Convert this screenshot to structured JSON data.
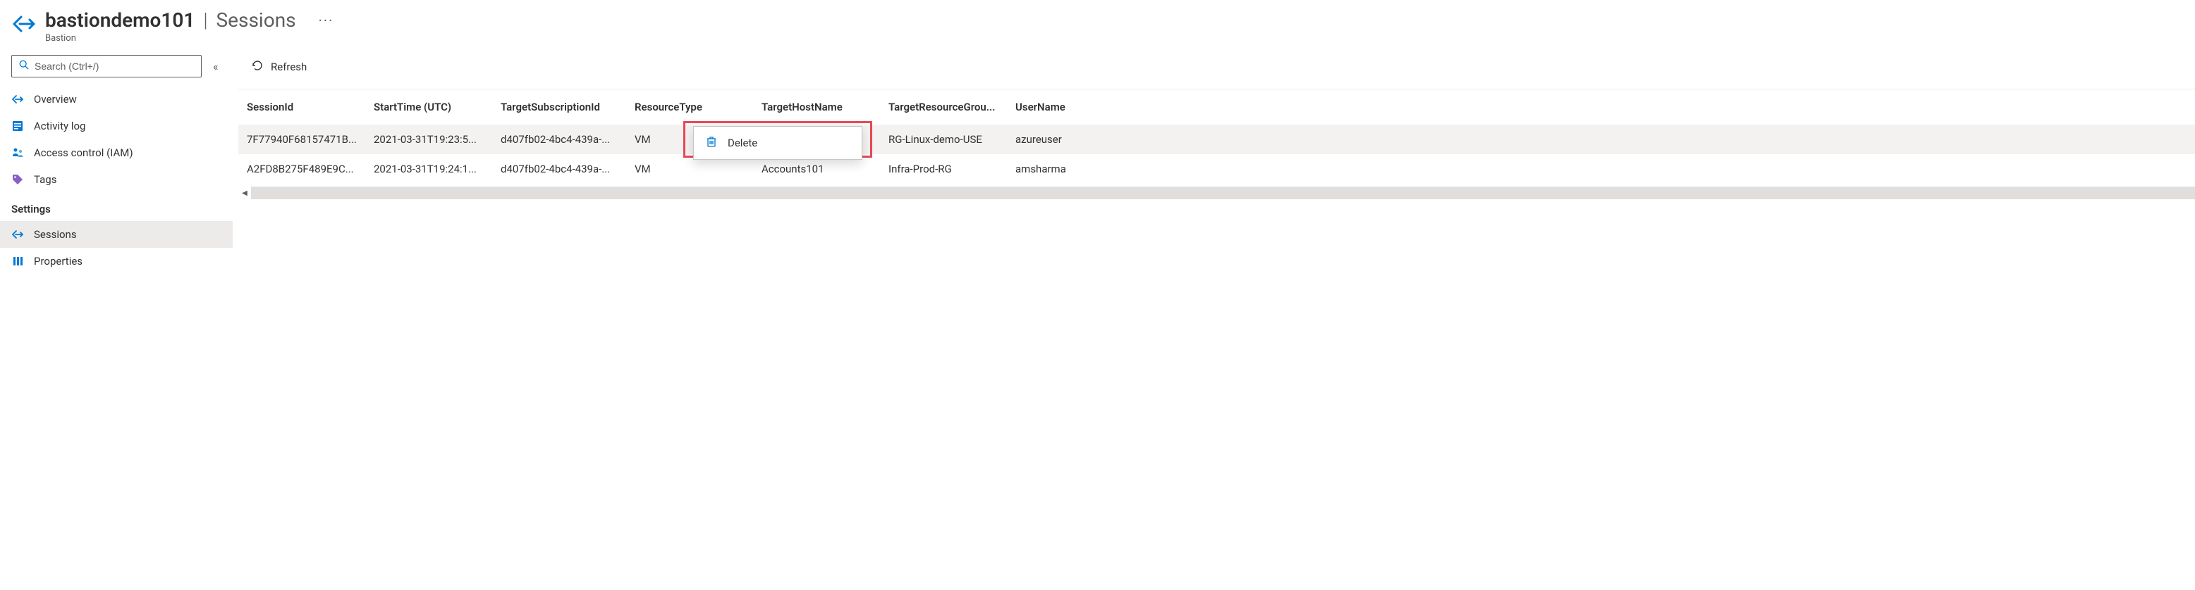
{
  "header": {
    "resource_name": "bastiondemo101",
    "section": "Sessions",
    "resource_type": "Bastion",
    "more": "···"
  },
  "search": {
    "placeholder": "Search (Ctrl+/)"
  },
  "nav": {
    "overview": "Overview",
    "activity_log": "Activity log",
    "iam": "Access control (IAM)",
    "tags": "Tags",
    "settings_label": "Settings",
    "sessions": "Sessions",
    "properties": "Properties"
  },
  "toolbar": {
    "refresh": "Refresh"
  },
  "table": {
    "headers": {
      "session_id": "SessionId",
      "start_time": "StartTime (UTC)",
      "subscription": "TargetSubscriptionId",
      "resource_type": "ResourceType",
      "host_name": "TargetHostName",
      "resource_group": "TargetResourceGrou...",
      "user_name": "UserName"
    },
    "rows": [
      {
        "session_id": "7F77940F68157471B...",
        "start_time": "2021-03-31T19:23:5...",
        "subscription": "d407fb02-4bc4-439a-...",
        "resource_type": "VM",
        "host_name": "",
        "resource_group": "RG-Linux-demo-USE",
        "user_name": "azureuser"
      },
      {
        "session_id": "A2FD8B275F489E9C...",
        "start_time": "2021-03-31T19:24:1...",
        "subscription": "d407fb02-4bc4-439a-...",
        "resource_type": "VM",
        "host_name": "Accounts101",
        "resource_group": "Infra-Prod-RG",
        "user_name": "amsharma"
      }
    ]
  },
  "context_menu": {
    "delete": "Delete"
  }
}
